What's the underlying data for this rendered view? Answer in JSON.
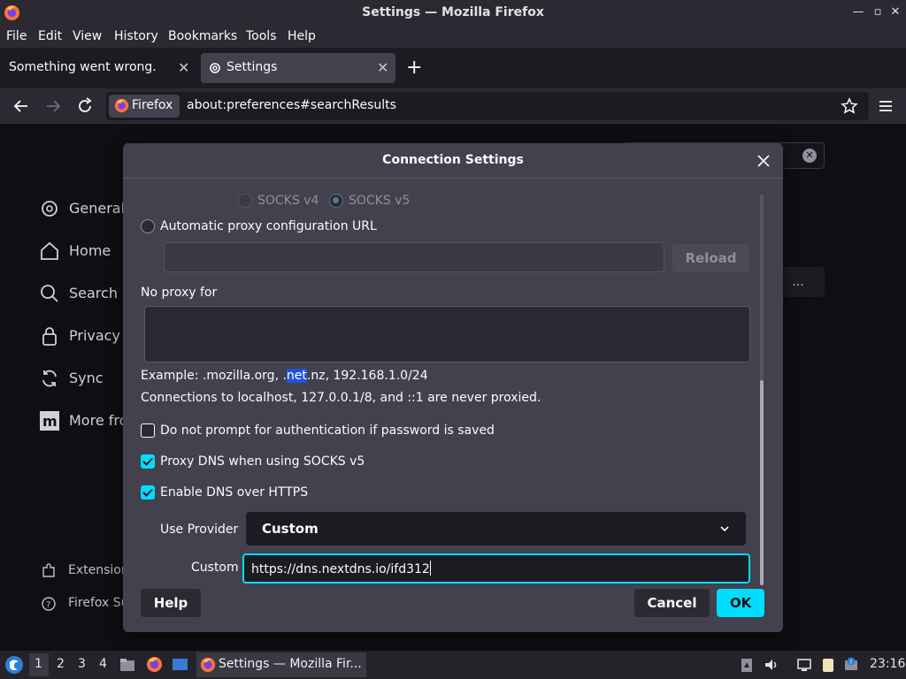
{
  "window": {
    "title": "Settings — Mozilla Firefox"
  },
  "menu": [
    "File",
    "Edit",
    "View",
    "History",
    "Bookmarks",
    "Tools",
    "Help"
  ],
  "tabs": [
    {
      "label": "Something went wrong.",
      "active": false
    },
    {
      "label": "Settings",
      "active": true
    }
  ],
  "urlbar": {
    "identity": "Firefox",
    "url": "about:preferences#searchResults"
  },
  "prefs_nav": [
    {
      "label": "General",
      "icon": "gear-icon"
    },
    {
      "label": "Home",
      "icon": "home-icon"
    },
    {
      "label": "Search",
      "icon": "search-icon"
    },
    {
      "label": "Privacy",
      "icon": "lock-icon"
    },
    {
      "label": "Sync",
      "icon": "sync-icon"
    },
    {
      "label": "More fro",
      "icon": "mozilla-icon"
    }
  ],
  "prefs_footer": [
    {
      "label": "Extension",
      "icon": "puzzle-icon"
    },
    {
      "label": "Firefox Su",
      "icon": "help-icon"
    }
  ],
  "bg_more": "...",
  "dialog": {
    "title": "Connection Settings",
    "socks_v4": "SOCKS v4",
    "socks_v5": "SOCKS v5",
    "auto_proxy_label": "Automatic proxy configuration URL",
    "auto_proxy_value": "",
    "reload": "Reload",
    "no_proxy_label": "No proxy for",
    "no_proxy_value": "",
    "example_pre": "Example: .mozilla.org, .",
    "example_hl": "net",
    "example_post": ".nz, 192.168.1.0/24",
    "localhost_note": "Connections to localhost, 127.0.0.1/8, and ::1 are never proxied.",
    "no_auth_prompt": {
      "label": "Do not prompt for authentication if password is saved",
      "checked": false
    },
    "proxy_dns": {
      "label": "Proxy DNS when using SOCKS v5",
      "checked": true
    },
    "dns_https": {
      "label": "Enable DNS over HTTPS",
      "checked": true
    },
    "use_provider_label": "Use Provider",
    "provider_value": "Custom",
    "custom_label": "Custom",
    "custom_value": "https://dns.nextdns.io/ifd312",
    "help": "Help",
    "cancel": "Cancel",
    "ok": "OK"
  },
  "taskbar": {
    "workspaces": [
      "1",
      "2",
      "3",
      "4"
    ],
    "task_label": "Settings — Mozilla Fir...",
    "clock": "23:16"
  },
  "colors": {
    "accent": "#00ddff",
    "dialog_bg": "#42414d",
    "selection": "#2054d8"
  }
}
